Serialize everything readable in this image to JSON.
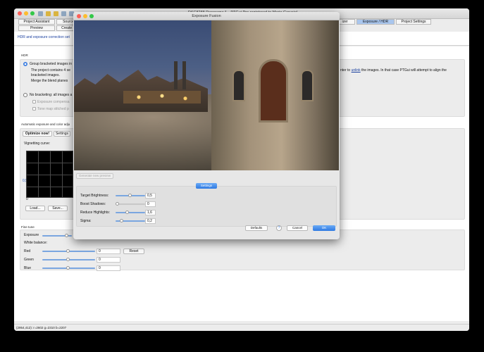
{
  "window": {
    "title": "_DSC8288 Panorama * – PTGui Pro registered to Mario Carvajal"
  },
  "tabs_row1": [
    {
      "label": "Project Assistant"
    },
    {
      "label": "Source"
    },
    {
      "label": "izer"
    },
    {
      "label": "Exposure / HDR",
      "active": true
    },
    {
      "label": "Project Settings"
    }
  ],
  "tabs_row2": [
    {
      "label": "Preview"
    },
    {
      "label": "Create P"
    }
  ],
  "header": {
    "text": "HDR and exposure correction set"
  },
  "hdr": {
    "label": "HDR",
    "group_option": "Group bracketed images in",
    "group_desc1": "The project contains 4 se",
    "group_desc2": "bracketed images.",
    "group_desc_right_pre": "nter to ",
    "group_desc_right_link": "unlink",
    "group_desc_right_post": " the images. In that case PTGui will attempt to align the",
    "merge_text": "Merge the blend planes",
    "no_bracket": "No bracketing: all images a",
    "exposure_comp": "Exposure compensa",
    "tonemap": "Tone map stitched p"
  },
  "auto": {
    "label": "Automatic exposure and color adju",
    "optimize_btn": "Optimize now!",
    "settings_btn": "Settings",
    "vignetting_label": "Vignetting curve:",
    "axis_top": "1",
    "axis_mid": "0,5",
    "axis_bottom": "0",
    "load_btn": "Load...",
    "save_btn": "Save..."
  },
  "finetune": {
    "label": "Fine tune",
    "exposure": "Exposure",
    "white_balance": "White balance:",
    "red": "Red",
    "green": "Green",
    "blue": "Blue",
    "red_val": "0",
    "green_val": "0",
    "blue_val": "0",
    "reset_btn": "Reset"
  },
  "status": {
    "text": "(2954,412): r=2602  g=2310  b=2207"
  },
  "dialog": {
    "title": "Exposure Fusion",
    "generate_btn": "Generate new preview",
    "settings_btn": "Settings",
    "params": [
      {
        "label": "Target Brightness:",
        "value": "0,5",
        "level": 0.5
      },
      {
        "label": "Boost Shadows:",
        "value": "0",
        "level": 0.0
      },
      {
        "label": "Reduce Highlights:",
        "value": "1,6",
        "level": 0.4
      },
      {
        "label": "Sigma:",
        "value": "0,2",
        "level": 0.2
      }
    ],
    "defaults_btn": "Defaults",
    "help_btn": "?",
    "cancel_btn": "Cancel",
    "ok_btn": "OK"
  }
}
